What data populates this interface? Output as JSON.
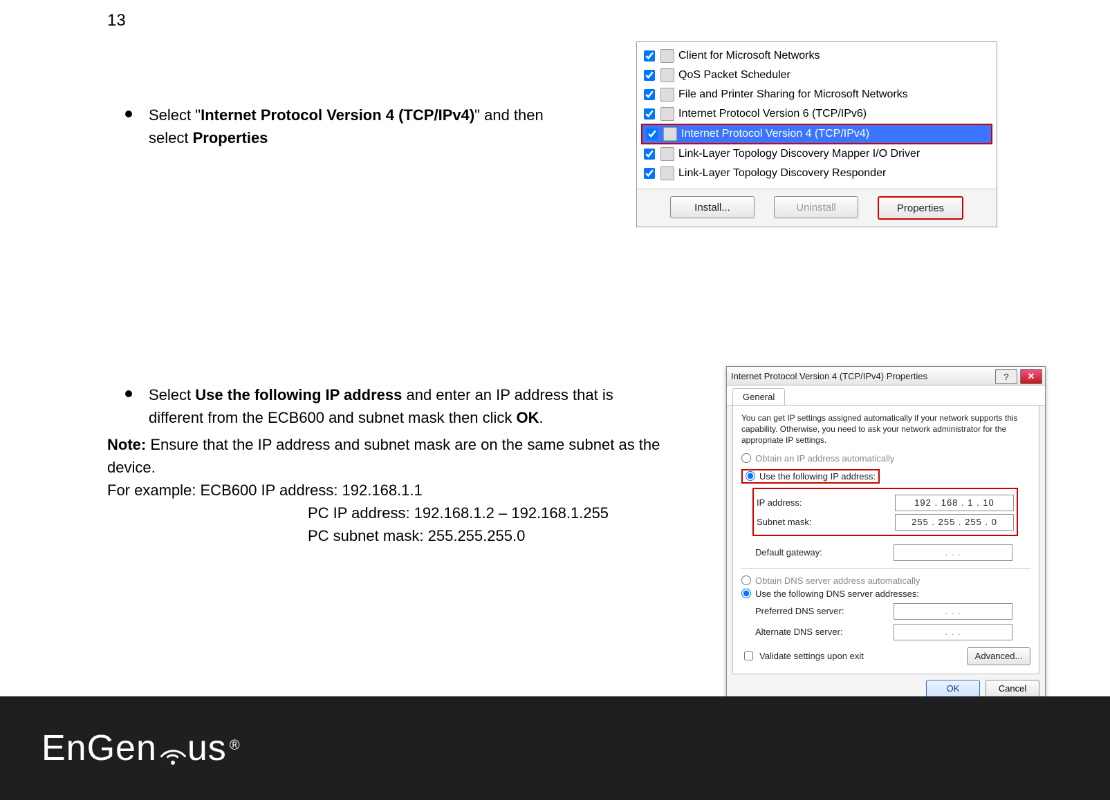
{
  "page_number": "13",
  "section1": {
    "pre": "Select \"",
    "bold1": "Internet Protocol Version 4 (TCP/IPv4)",
    "mid": "\" and then select ",
    "bold2": "Properties"
  },
  "section2": {
    "bullet_pre": "Select ",
    "bullet_b1": "Use the following IP address",
    "bullet_mid": " and enter an IP address that is different from the ECB600 and subnet mask then click ",
    "bullet_b2": "OK",
    "bullet_end": ".",
    "note_label": "Note:",
    "note_text": " Ensure that the IP address and subnet mask are on the same subnet as the device.",
    "example_label": "For example:",
    "example_l1": " ECB600 IP address: 192.168.1.1",
    "example_l2": "PC IP address: 192.168.1.2 – 192.168.1.255",
    "example_l3": "PC subnet mask: 255.255.255.0"
  },
  "shot1": {
    "items": [
      {
        "label": "Client for Microsoft Networks",
        "checked": true,
        "selected": false
      },
      {
        "label": "QoS Packet Scheduler",
        "checked": true,
        "selected": false
      },
      {
        "label": "File and Printer Sharing for Microsoft Networks",
        "checked": true,
        "selected": false
      },
      {
        "label": "Internet Protocol Version 6 (TCP/IPv6)",
        "checked": true,
        "selected": false
      },
      {
        "label": "Internet Protocol Version 4 (TCP/IPv4)",
        "checked": true,
        "selected": true
      },
      {
        "label": "Link-Layer Topology Discovery Mapper I/O Driver",
        "checked": true,
        "selected": false
      },
      {
        "label": "Link-Layer Topology Discovery Responder",
        "checked": true,
        "selected": false
      }
    ],
    "install": "Install...",
    "uninstall": "Uninstall",
    "properties": "Properties"
  },
  "shot2": {
    "title": "Internet Protocol Version 4 (TCP/IPv4) Properties",
    "help": "?",
    "close": "✕",
    "tab": "General",
    "desc": "You can get IP settings assigned automatically if your network supports this capability. Otherwise, you need to ask your network administrator for the appropriate IP settings.",
    "r_auto_ip": "Obtain an IP address automatically",
    "r_use_ip": "Use the following IP address:",
    "ip_label": "IP address:",
    "ip_value": "192 . 168 .   1   .  10",
    "mask_label": "Subnet mask:",
    "mask_value": "255 . 255 . 255 .   0",
    "gw_label": "Default gateway:",
    "gw_value": ".       .       .",
    "r_auto_dns": "Obtain DNS server address automatically",
    "r_use_dns": "Use the following DNS server addresses:",
    "pref_label": "Preferred DNS server:",
    "pref_value": ".       .       .",
    "alt_label": "Alternate DNS server:",
    "alt_value": ".       .       .",
    "validate": "Validate settings upon exit",
    "advanced": "Advanced...",
    "ok": "OK",
    "cancel": "Cancel"
  },
  "brand": {
    "name": "EnGen",
    "suffix": "us",
    "reg": "®"
  }
}
